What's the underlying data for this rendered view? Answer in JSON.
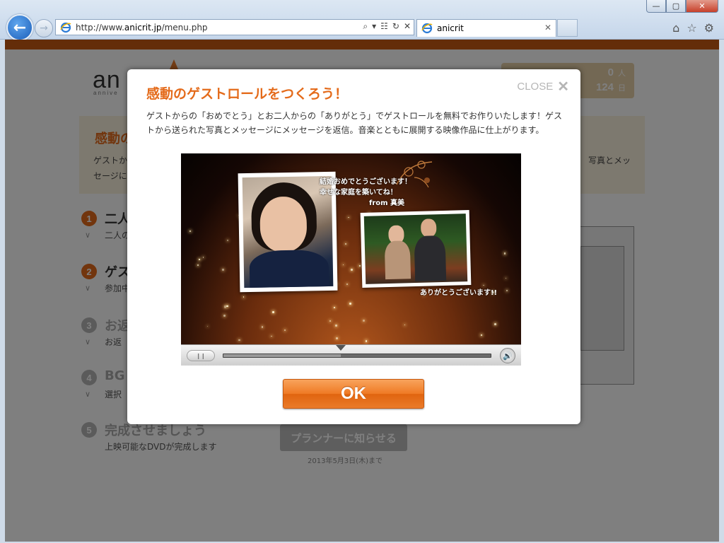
{
  "browser": {
    "url_prefix": "http://www.",
    "url_host": "anicrit.jp",
    "url_path": "/menu.php",
    "tab_title": "anicrit",
    "window_buttons": [
      "—",
      "▢",
      "✕"
    ]
  },
  "page": {
    "logo": "an",
    "logo_sub": "annive",
    "counter": {
      "value1": "0",
      "unit1": "人",
      "value2": "124",
      "unit2": "日"
    },
    "intro": {
      "title": "感動の",
      "text_left": "ゲストか",
      "text_left2": "セージに",
      "text_right": "写真とメッ"
    },
    "steps": [
      {
        "num": "1",
        "title": "二人",
        "desc": "二人の"
      },
      {
        "num": "2",
        "title": "ゲス",
        "desc": "参加中"
      },
      {
        "num": "3",
        "title": "お返",
        "desc": "お返"
      },
      {
        "num": "4",
        "title": "BG",
        "desc": "選択"
      },
      {
        "num": "5",
        "title": "完成させましょう",
        "desc": "上映可能なDVDが完成します"
      }
    ],
    "planner_button": "プランナーに知らせる",
    "deadline": "2013年5月3日(木)まで"
  },
  "modal": {
    "title": "感動のゲストロールをつくろう！",
    "close_label": "CLOSE",
    "description": "ゲストからの「おめでとう」とお二人からの「ありがとう」でゲストロールを無料でお作りいたします！ゲストから送られた写真とメッセージにメッセージを返信。音楽とともに展開する映像作品に仕上がります。",
    "video": {
      "message_line1": "結婚おめでとうございます！",
      "message_line2": "幸せな家庭を築いてね！",
      "from_line": "from 真美",
      "reply": "ありがとうございます!!",
      "progress": 0.44
    },
    "ok_label": "OK"
  }
}
